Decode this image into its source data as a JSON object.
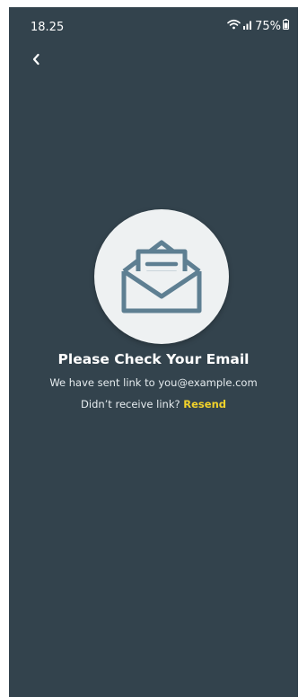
{
  "status_bar": {
    "time": "18.25",
    "battery": "75%"
  },
  "navigation": {
    "back_icon": "chevron-left-icon"
  },
  "illustration": {
    "icon": "open-envelope-icon"
  },
  "content": {
    "title": "Please Check Your Email",
    "subtitle": "We have sent link to you@example.com",
    "resend_prompt": "Didn’t receive link?",
    "resend_link": "Resend"
  },
  "colors": {
    "background": "#33434d",
    "accent": "#f2d22b",
    "icon_stroke": "#5e7f92",
    "circle": "#eef1f2"
  }
}
